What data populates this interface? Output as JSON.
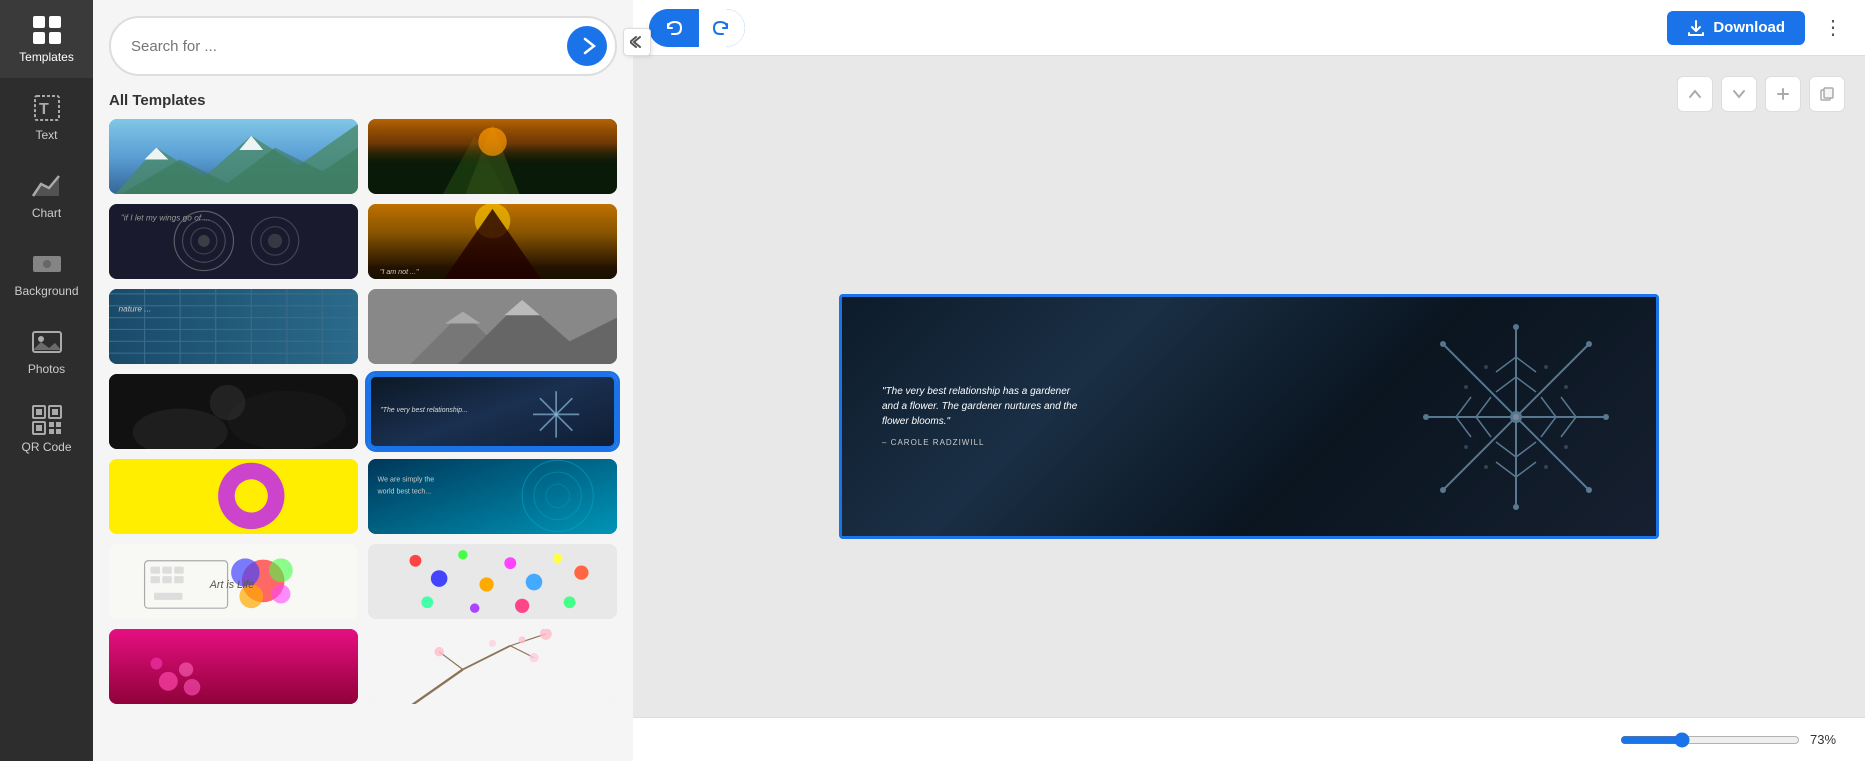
{
  "sidebar": {
    "items": [
      {
        "id": "templates",
        "label": "Templates",
        "icon": "grid-icon",
        "active": true
      },
      {
        "id": "text",
        "label": "Text",
        "icon": "text-icon",
        "active": false
      },
      {
        "id": "chart",
        "label": "Chart",
        "icon": "chart-icon",
        "active": false
      },
      {
        "id": "background",
        "label": "Background",
        "icon": "background-icon",
        "active": false
      },
      {
        "id": "photos",
        "label": "Photos",
        "icon": "photos-icon",
        "active": false
      },
      {
        "id": "qrcode",
        "label": "QR Code",
        "icon": "qr-icon",
        "active": false
      }
    ]
  },
  "panel": {
    "search_placeholder": "Search for ...",
    "search_btn_label": "→",
    "title": "All Templates",
    "collapse_label": "<<"
  },
  "toolbar": {
    "undo_label": "Undo",
    "redo_label": "Redo",
    "download_label": "Download",
    "more_label": "⋮",
    "slide_up_label": "↑",
    "slide_down_label": "↓",
    "slide_add_label": "+",
    "slide_copy_label": "⧉"
  },
  "slide": {
    "quote": "\"The very best relationship has a gardener and a flower. The gardener nurtures and the flower blooms.\"",
    "author": "– CAROLE RADZIWILL"
  },
  "zoom": {
    "value": 73,
    "label": "73%",
    "min": 10,
    "max": 200
  }
}
